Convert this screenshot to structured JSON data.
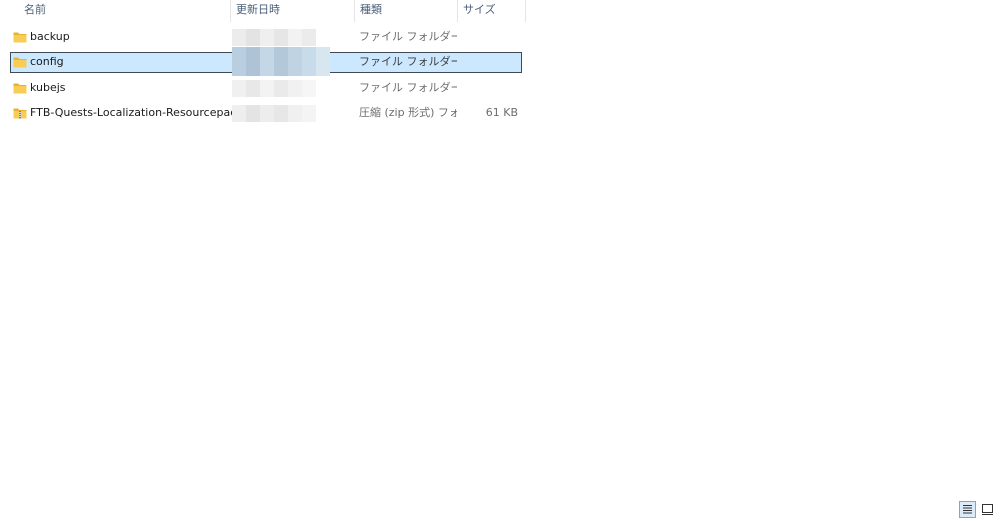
{
  "columns": {
    "name": "名前",
    "date": "更新日時",
    "type": "種類",
    "size": "サイズ"
  },
  "files": [
    {
      "name": "backup",
      "type": "ファイル フォルダー",
      "size": "",
      "icon": "folder-icon",
      "selected": false
    },
    {
      "name": "config",
      "type": "ファイル フォルダー",
      "size": "",
      "icon": "folder-icon",
      "selected": true
    },
    {
      "name": "kubejs",
      "type": "ファイル フォルダー",
      "size": "",
      "icon": "folder-icon",
      "selected": false
    },
    {
      "name": "FTB-Quests-Localization-Resourcepack.zip",
      "type": "圧縮 (zip 形式) フォ...",
      "size": "61 KB",
      "icon": "zip-folder-icon",
      "selected": false
    }
  ],
  "view_buttons": [
    {
      "name": "details-view",
      "icon": "details-view-icon",
      "active": true
    },
    {
      "name": "tiles-view",
      "icon": "large-icons-view-icon",
      "active": false
    }
  ],
  "colors": {
    "header_text": "#4c607a",
    "selection_bg": "#cce8ff",
    "folder_yellow": "#f5c342"
  }
}
